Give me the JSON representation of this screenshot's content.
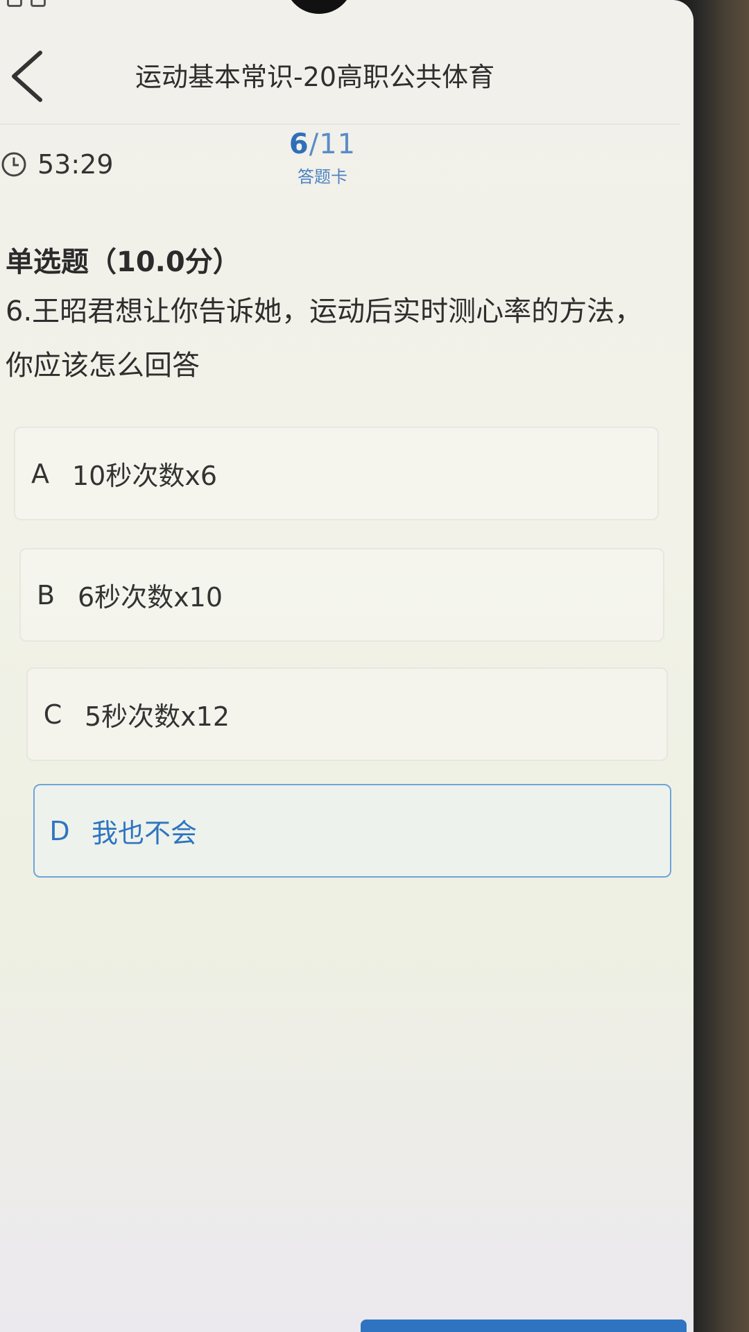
{
  "header": {
    "title": "运动基本常识-20高职公共体育"
  },
  "timer": {
    "value": "53:29"
  },
  "progress": {
    "current": "6",
    "separator": "/",
    "total": "11",
    "answer_card_label": "答题卡"
  },
  "question": {
    "type_label": "单选题（10.0分）",
    "text": "6.王昭君想让你告诉她，运动后实时测心率的方法，你应该怎么回答"
  },
  "options": [
    {
      "letter": "A",
      "text": "10秒次数x6",
      "selected": false
    },
    {
      "letter": "B",
      "text": "6秒次数x10",
      "selected": false
    },
    {
      "letter": "C",
      "text": "5秒次数x12",
      "selected": false
    },
    {
      "letter": "D",
      "text": "我也不会",
      "selected": true
    }
  ],
  "colors": {
    "accent": "#2f74c0",
    "selected_border": "#6fa4d8"
  }
}
